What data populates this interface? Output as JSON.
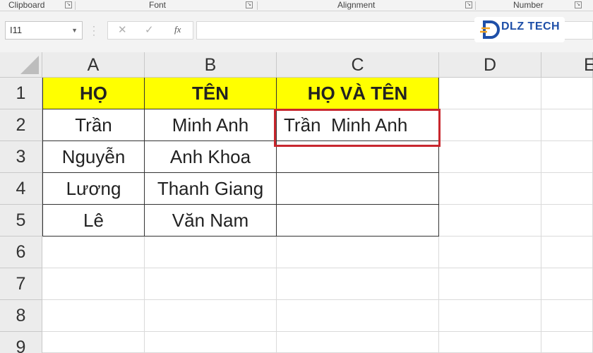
{
  "ribbon": {
    "groups": [
      "Clipboard",
      "Font",
      "Alignment",
      "Number"
    ]
  },
  "formula_bar": {
    "name_box": "I11",
    "cancel_icon": "✕",
    "enter_icon": "✓",
    "fx_label": "fx",
    "formula": ""
  },
  "logo": {
    "text": "DLZ TECH"
  },
  "columns": [
    "A",
    "B",
    "C",
    "D",
    "E"
  ],
  "rows": [
    "1",
    "2",
    "3",
    "4",
    "5",
    "6",
    "7",
    "8",
    "9"
  ],
  "table": {
    "headers": [
      "HỌ",
      "TÊN",
      "HỌ VÀ TÊN"
    ],
    "rows": [
      [
        "Trần",
        "Minh Anh",
        "Trần  Minh Anh"
      ],
      [
        "Nguyễn",
        "Anh Khoa",
        ""
      ],
      [
        "Lương",
        "Thanh Giang",
        ""
      ],
      [
        "Lê",
        "Văn Nam",
        ""
      ]
    ]
  },
  "colors": {
    "header_fill": "#ffff00",
    "highlight_border": "#c8272e"
  }
}
